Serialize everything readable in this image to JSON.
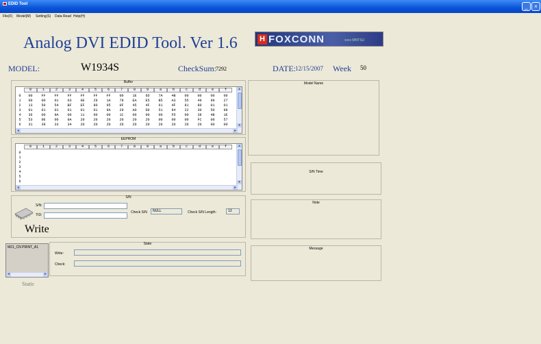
{
  "window": {
    "title": "EDID Tool",
    "min": "_",
    "close": "×"
  },
  "menu": [
    "File(F)",
    "Model(M)",
    "Setting(S)",
    "Data Read",
    "Help(H)"
  ],
  "app_title": "Analog  DVI  EDID  Tool. Ver 1.6",
  "logo": {
    "text": "FOXCONN",
    "sub": "xxxx MNTSU"
  },
  "model_label": "MODEL:",
  "model_value": "W1934S",
  "checksum_label": "CheckSum:",
  "checksum_value": "7292",
  "date_label": "DATE:",
  "date_value": "12/15/2007",
  "week_label": "Week",
  "week_value": "50",
  "buffer": {
    "title": "Buffer",
    "headers": [
      "0",
      "1",
      "2",
      "3",
      "4",
      "5",
      "6",
      "7",
      "8",
      "9",
      "a",
      "b",
      "c",
      "d",
      "e",
      "f"
    ],
    "rows": [
      {
        "idx": "0",
        "vals": [
          "00",
          "FF",
          "FF",
          "FF",
          "FF",
          "FF",
          "FF",
          "00",
          "1E",
          "6D",
          "7A",
          "4B",
          "00",
          "00",
          "00",
          "00"
        ]
      },
      {
        "idx": "1",
        "vals": [
          "00",
          "00",
          "01",
          "03",
          "0E",
          "29",
          "1A",
          "78",
          "EA",
          "E5",
          "B5",
          "A3",
          "55",
          "49",
          "99",
          "27"
        ]
      },
      {
        "idx": "2",
        "vals": [
          "13",
          "50",
          "54",
          "BF",
          "EF",
          "80",
          "95",
          "0F",
          "45",
          "4F",
          "61",
          "4F",
          "81",
          "80",
          "01",
          "01"
        ]
      },
      {
        "idx": "3",
        "vals": [
          "01",
          "01",
          "01",
          "01",
          "01",
          "01",
          "9A",
          "29",
          "A0",
          "D0",
          "51",
          "84",
          "22",
          "30",
          "50",
          "98"
        ]
      },
      {
        "idx": "4",
        "vals": [
          "36",
          "00",
          "9A",
          "00",
          "11",
          "00",
          "00",
          "1C",
          "00",
          "00",
          "00",
          "FD",
          "00",
          "38",
          "4B",
          "1E"
        ]
      },
      {
        "idx": "5",
        "vals": [
          "53",
          "0E",
          "00",
          "0A",
          "20",
          "20",
          "20",
          "20",
          "20",
          "20",
          "00",
          "00",
          "00",
          "FC",
          "00",
          "57"
        ]
      },
      {
        "idx": "6",
        "vals": [
          "31",
          "39",
          "33",
          "34",
          "20",
          "20",
          "20",
          "20",
          "20",
          "20",
          "20",
          "20",
          "20",
          "20",
          "00",
          "00"
        ]
      }
    ]
  },
  "eeprom": {
    "title": "EEPROM",
    "headers": [
      "0",
      "1",
      "2",
      "3",
      "4",
      "5",
      "6",
      "7",
      "8",
      "9",
      "a",
      "b",
      "c",
      "d",
      "e",
      "f"
    ],
    "rows": [
      "0",
      "1",
      "2",
      "3",
      "4",
      "5",
      "6"
    ]
  },
  "sn_panel": {
    "title": "S/N",
    "sn_label": "S/N:",
    "tid_label": "TID:",
    "write_label": "Write",
    "check_label": "Check S/N",
    "check_value": "NULL",
    "length_label": "Check S/N Length:",
    "length_value": "13"
  },
  "state_panel": {
    "title": "State",
    "write_label": "Write:",
    "check_label": "Check:"
  },
  "static_panel": {
    "item": "M21_CN PRINT_A1",
    "label": "Static"
  },
  "right_panels": {
    "model_name": "Model Name",
    "sn_time": "S/N Time",
    "note": "Note",
    "message": "Message"
  },
  "colors": {
    "title_blue": "#1f3f97",
    "titlebar": "#0a54d8",
    "background": "#ece9d8"
  }
}
